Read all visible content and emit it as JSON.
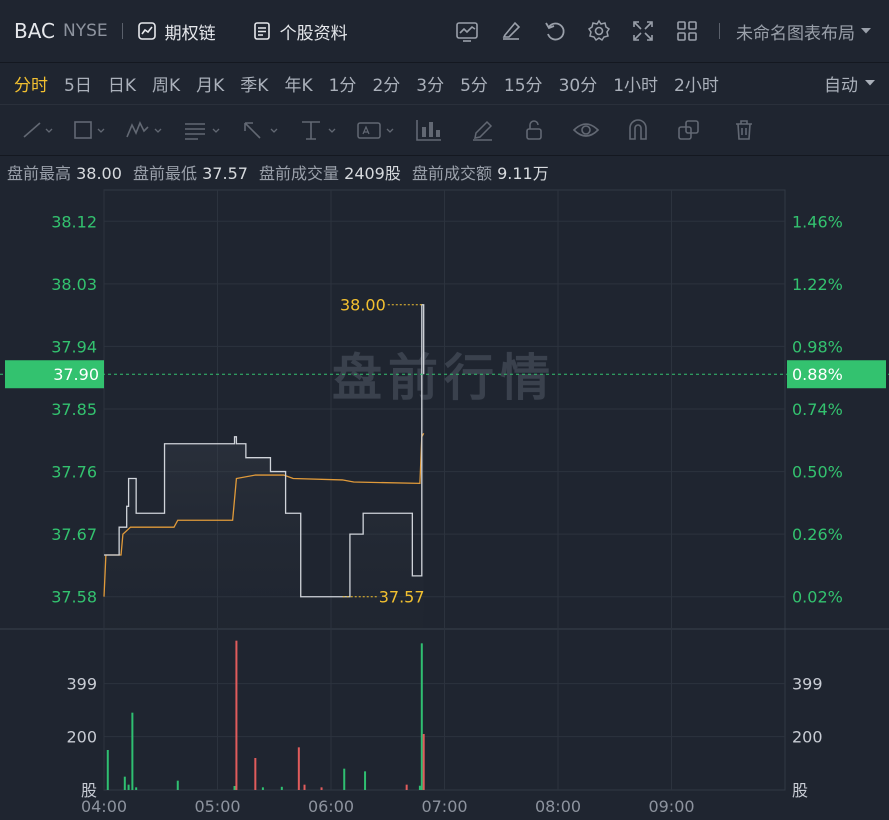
{
  "header": {
    "symbol": "BAC",
    "exchange": "NYSE",
    "options_chain": "期权链",
    "stock_profile": "个股资料",
    "layout_name": "未命名图表布局",
    "icons": [
      "indicator-icon",
      "draw-icon",
      "reset-icon",
      "settings-icon",
      "fullscreen-icon",
      "layout-grid-icon"
    ]
  },
  "periods": {
    "items": [
      "分时",
      "5日",
      "日K",
      "周K",
      "月K",
      "季K",
      "年K",
      "1分",
      "2分",
      "3分",
      "5分",
      "15分",
      "30分",
      "1小时",
      "2小时"
    ],
    "active": "分时",
    "auto_label": "自动"
  },
  "drawing_tools": [
    "line-tool-icon",
    "rect-tool-icon",
    "pattern-tool-icon",
    "fib-tool-icon",
    "arrow-tool-icon",
    "measure-tool-icon",
    "text-tool-icon",
    "volume-profile-icon",
    "pen-icon",
    "lock-icon",
    "eye-icon",
    "magnet-icon",
    "copy-icon",
    "trash-icon"
  ],
  "premarket_info": {
    "high_label": "盘前最高",
    "high": "38.00",
    "low_label": "盘前最低",
    "low": "37.57",
    "volume_label": "盘前成交量",
    "volume": "2409股",
    "amount_label": "盘前成交额",
    "amount": "9.11万"
  },
  "chart_data": {
    "type": "line",
    "watermark": "盘前行情",
    "current_price": "37.90",
    "current_pct": "0.88%",
    "high_marker": "38.00",
    "low_marker": "37.57",
    "price_ticks": [
      "38.12",
      "38.03",
      "37.94",
      "37.85",
      "37.76",
      "37.67",
      "37.58"
    ],
    "pct_ticks": [
      "1.46%",
      "1.22%",
      "0.98%",
      "0.74%",
      "0.50%",
      "0.26%",
      "0.02%"
    ],
    "time_ticks": [
      "04:00",
      "05:00",
      "06:00",
      "07:00",
      "08:00",
      "09:00"
    ],
    "volume_ticks": [
      "399",
      "200"
    ],
    "volume_unit": "股",
    "ylim": [
      37.535,
      38.165
    ],
    "price_series": [
      [
        "04:00",
        37.64
      ],
      [
        "04:05",
        37.64
      ],
      [
        "04:08",
        37.68
      ],
      [
        "04:12",
        37.71
      ],
      [
        "04:13",
        37.75
      ],
      [
        "04:16",
        37.75
      ],
      [
        "04:17",
        37.7
      ],
      [
        "04:30",
        37.7
      ],
      [
        "04:32",
        37.8
      ],
      [
        "05:08",
        37.8
      ],
      [
        "05:09",
        37.81
      ],
      [
        "05:10",
        37.8
      ],
      [
        "05:14",
        37.8
      ],
      [
        "05:15",
        37.78
      ],
      [
        "05:27",
        37.78
      ],
      [
        "05:28",
        37.76
      ],
      [
        "05:35",
        37.76
      ],
      [
        "05:36",
        37.7
      ],
      [
        "05:42",
        37.7
      ],
      [
        "05:44",
        37.58
      ],
      [
        "06:09",
        37.58
      ],
      [
        "06:10",
        37.67
      ],
      [
        "06:16",
        37.67
      ],
      [
        "06:17",
        37.7
      ],
      [
        "06:42",
        37.7
      ],
      [
        "06:43",
        37.61
      ],
      [
        "06:47",
        37.61
      ],
      [
        "06:48",
        38.0
      ],
      [
        "06:49",
        37.9
      ]
    ],
    "avg_series": [
      [
        "04:00",
        37.58
      ],
      [
        "04:01",
        37.64
      ],
      [
        "04:09",
        37.64
      ],
      [
        "04:10",
        37.67
      ],
      [
        "04:14",
        37.68
      ],
      [
        "04:37",
        37.68
      ],
      [
        "04:39",
        37.69
      ],
      [
        "05:08",
        37.69
      ],
      [
        "05:10",
        37.75
      ],
      [
        "05:20",
        37.755
      ],
      [
        "05:35",
        37.755
      ],
      [
        "05:40",
        37.75
      ],
      [
        "06:06",
        37.748
      ],
      [
        "06:12",
        37.745
      ],
      [
        "06:47",
        37.743
      ],
      [
        "06:48",
        37.81
      ],
      [
        "06:49",
        37.815
      ]
    ],
    "volume_series": [
      [
        "04:02",
        150,
        "up"
      ],
      [
        "04:11",
        50,
        "up"
      ],
      [
        "04:13",
        20,
        "up"
      ],
      [
        "04:15",
        290,
        "up"
      ],
      [
        "04:17",
        10,
        "up"
      ],
      [
        "04:39",
        35,
        "up"
      ],
      [
        "05:09",
        15,
        "up"
      ],
      [
        "05:10",
        560,
        "down"
      ],
      [
        "05:20",
        120,
        "down"
      ],
      [
        "05:24",
        10,
        "up"
      ],
      [
        "05:34",
        12,
        "up"
      ],
      [
        "05:43",
        160,
        "down"
      ],
      [
        "05:46",
        20,
        "down"
      ],
      [
        "05:55",
        10,
        "down"
      ],
      [
        "06:07",
        80,
        "up"
      ],
      [
        "06:18",
        70,
        "up"
      ],
      [
        "06:40",
        20,
        "down"
      ],
      [
        "06:47",
        16,
        "up"
      ],
      [
        "06:48",
        550,
        "up"
      ],
      [
        "06:49",
        210,
        "down"
      ]
    ],
    "colors": {
      "up": "#2fbf71",
      "down": "#e05c5c",
      "price": "#d0d4da",
      "avg": "#e09a3a",
      "marker": "#f2c030",
      "current": "#33c26f"
    }
  }
}
